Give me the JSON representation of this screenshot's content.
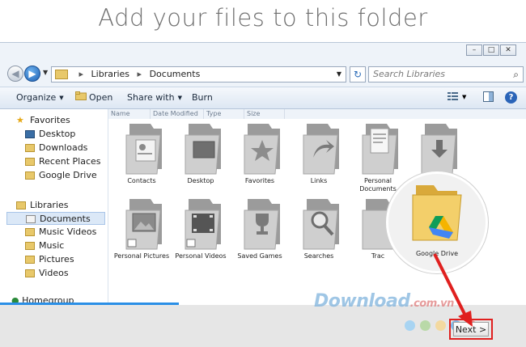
{
  "headline": "Add your files to this folder",
  "window": {
    "controls": [
      "–",
      "□",
      "✕"
    ]
  },
  "address": {
    "path_root": "Libraries",
    "path_leaf": "Documents",
    "search_placeholder": "Search Libraries"
  },
  "toolbar": {
    "organize": "Organize",
    "open": "Open",
    "share": "Share with",
    "burn": "Burn"
  },
  "nav": {
    "favorites": "Favorites",
    "desktop": "Desktop",
    "downloads": "Downloads",
    "recent": "Recent Places",
    "gdrive": "Google Drive",
    "libraries": "Libraries",
    "documents": "Documents",
    "music_videos": "Music Videos",
    "music": "Music",
    "pictures": "Pictures",
    "videos": "Videos",
    "homegroup": "Homegroup"
  },
  "columns": [
    "Name",
    "Date Modified",
    "Type",
    "Size"
  ],
  "folders_row1": [
    "Contacts",
    "Desktop",
    "Favorites",
    "Links",
    "Personal Documents",
    ""
  ],
  "folders_row2": [
    "Personal Pictures",
    "Personal Videos",
    "Saved Games",
    "Searches",
    "Trac"
  ],
  "spotlight": {
    "label": "Google Drive"
  },
  "next_button": "Next >",
  "progress_fraction": 0.34,
  "watermark": {
    "main": "Download",
    "suffix": ".com.vn"
  },
  "dot_colors": [
    "#a8d4f2",
    "#b9d9a8",
    "#f3d9a0",
    "#7fb7e6",
    "#f08b8b"
  ],
  "colors": {
    "accent": "#2a8fe6",
    "arrow": "#e0201f"
  }
}
